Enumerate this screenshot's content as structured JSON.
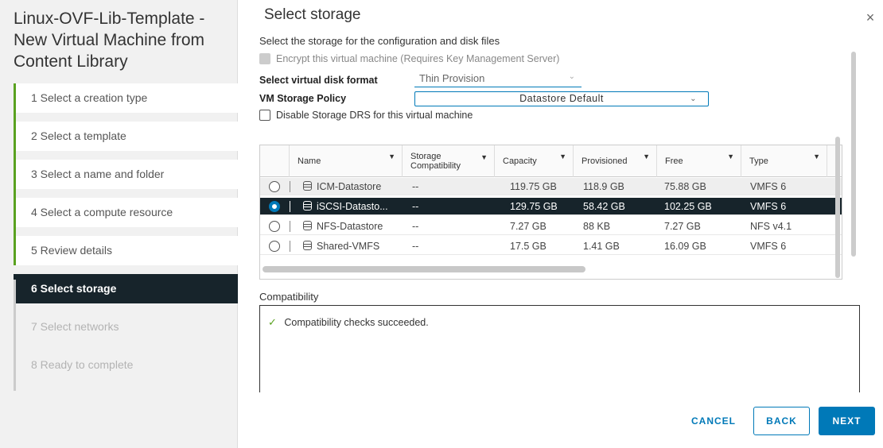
{
  "wizard": {
    "title": "Linux-OVF-Lib-Template - New Virtual Machine from Content Library",
    "steps": [
      {
        "label": "1  Select a creation type"
      },
      {
        "label": "2  Select a template"
      },
      {
        "label": "3  Select a name and folder"
      },
      {
        "label": "4  Select a compute resource"
      },
      {
        "label": "5  Review details"
      },
      {
        "label": "6  Select storage"
      },
      {
        "label": "7  Select networks"
      },
      {
        "label": "8  Ready to complete"
      }
    ]
  },
  "main": {
    "title": "Select storage",
    "close_icon": "×",
    "subtitle": "Select the storage for the configuration and disk files",
    "encrypt_label": "Encrypt this virtual machine (Requires Key Management Server)",
    "disk_format_label": "Select virtual disk format",
    "disk_format_value": "Thin Provision",
    "policy_label": "VM Storage Policy",
    "policy_value": "Datastore Default",
    "drs_label": "Disable Storage DRS for this virtual machine",
    "filter_icon": "▼",
    "chevron": "⌄"
  },
  "grid": {
    "columns": [
      "Name",
      "Storage Compatibility",
      "Capacity",
      "Provisioned",
      "Free",
      "Type"
    ],
    "rows": [
      {
        "name": "ICM-Datastore",
        "compat": "--",
        "capacity": "119.75 GB",
        "provisioned": "118.9 GB",
        "free": "75.88 GB",
        "type": "VMFS 6"
      },
      {
        "name": "iSCSI-Datasto...",
        "compat": "--",
        "capacity": "129.75 GB",
        "provisioned": "58.42 GB",
        "free": "102.25 GB",
        "type": "VMFS 6"
      },
      {
        "name": "NFS-Datastore",
        "compat": "--",
        "capacity": "7.27 GB",
        "provisioned": "88 KB",
        "free": "7.27 GB",
        "type": "NFS v4.1"
      },
      {
        "name": "Shared-VMFS",
        "compat": "--",
        "capacity": "17.5 GB",
        "provisioned": "1.41 GB",
        "free": "16.09 GB",
        "type": "VMFS 6"
      }
    ]
  },
  "compatibility": {
    "label": "Compatibility",
    "check_icon": "✓",
    "message": "Compatibility checks succeeded."
  },
  "buttons": {
    "cancel": "CANCEL",
    "back": "BACK",
    "next": "NEXT"
  },
  "colors": {
    "accent": "#0079b8",
    "selected_row": "#17242b",
    "done_step": "#5aa220"
  }
}
